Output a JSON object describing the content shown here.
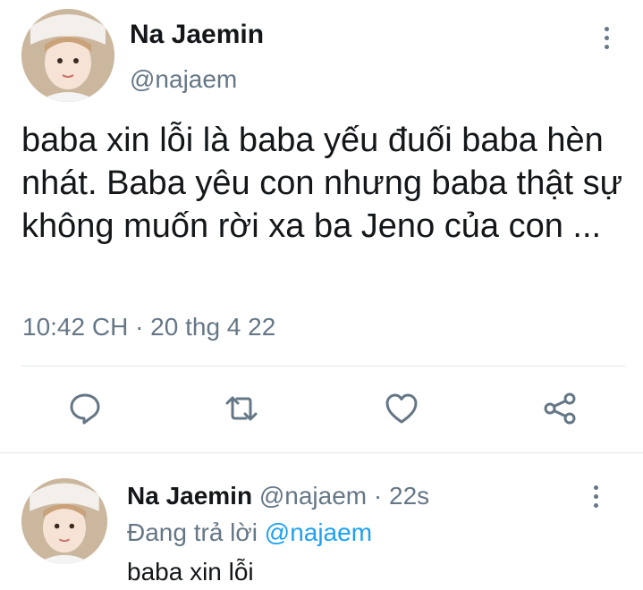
{
  "main_tweet": {
    "author_name": "Na Jaemin",
    "author_handle": "@najaem",
    "text": "baba xin lỗi là baba yếu đuối baba hèn nhát. Baba yêu con nhưng baba thật sự không muốn rời xa ba Jeno của con ...",
    "timestamp": "10:42 CH · 20 thg 4 22"
  },
  "actions": {
    "reply_icon": "speech-bubble-icon",
    "retweet_icon": "retweet-icon",
    "like_icon": "heart-icon",
    "share_icon": "share-icon"
  },
  "reply_tweet": {
    "author_name": "Na Jaemin",
    "author_handle": "@najaem",
    "time_ago": "· 22s",
    "replying_prefix": "Đang trả lời",
    "replying_to": "@najaem",
    "text": "baba xin lỗi"
  },
  "colors": {
    "text": "#14171a",
    "secondary": "#657786",
    "link": "#1da1f2",
    "divider": "#e1e8ed"
  }
}
